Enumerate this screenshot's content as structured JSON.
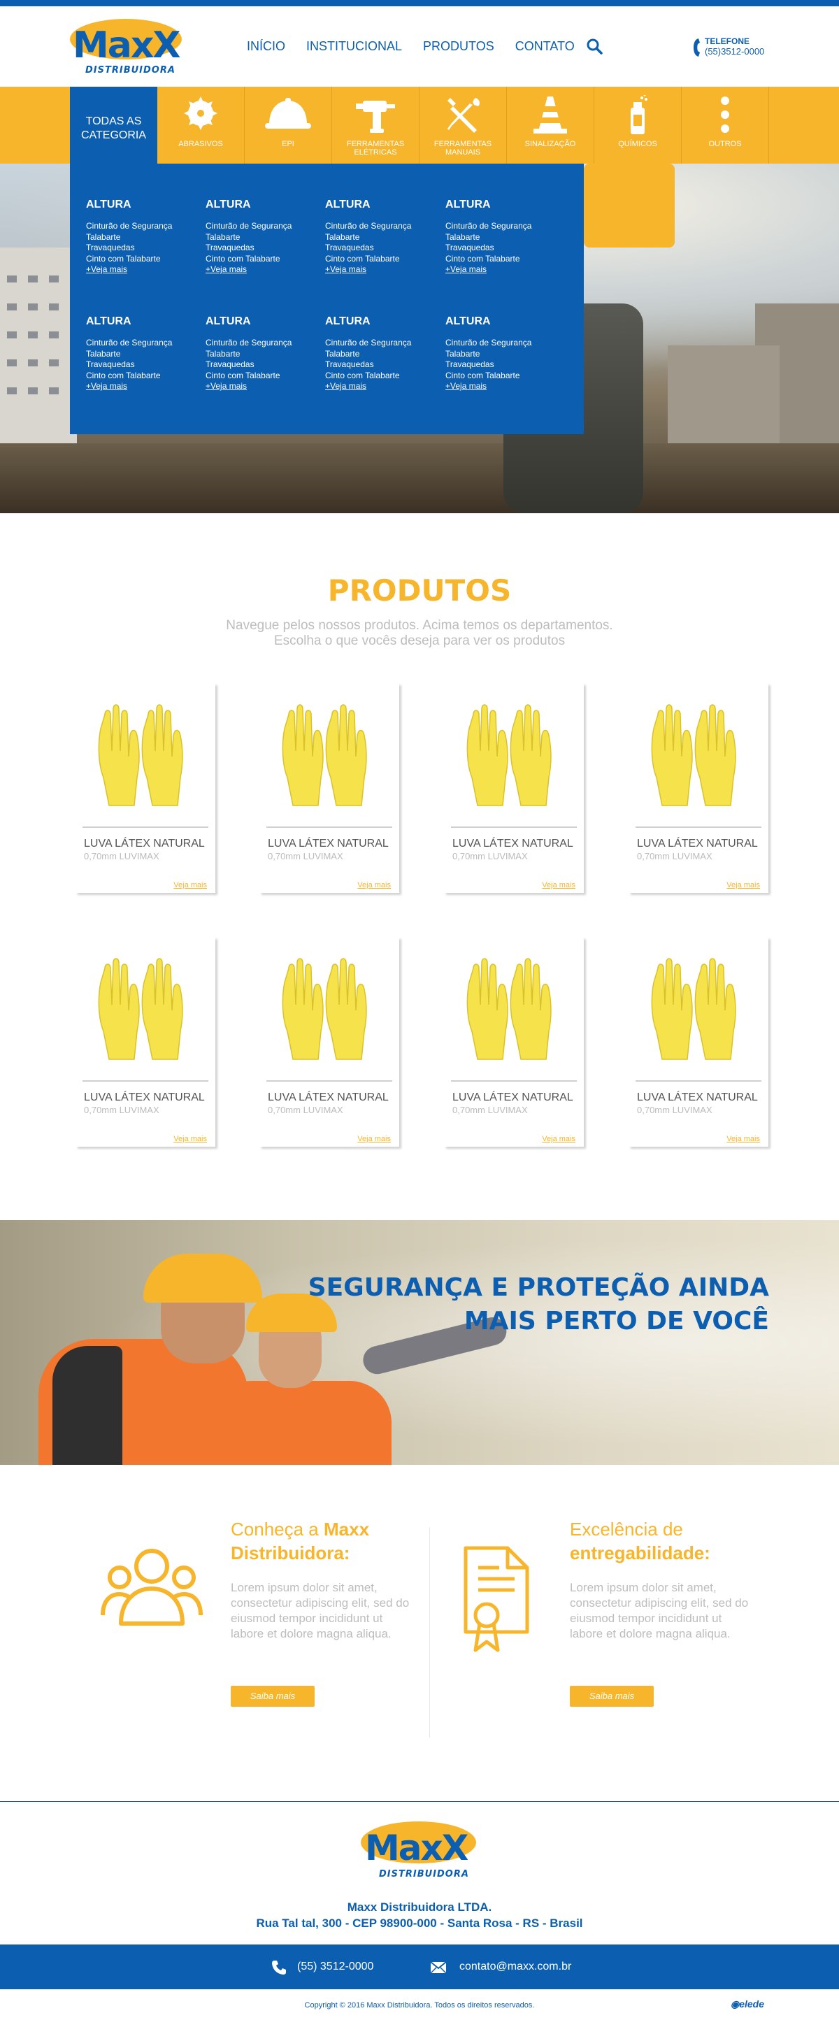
{
  "header": {
    "logo_text": "MaxX",
    "logo_sub": "DISTRIBUIDORA",
    "nav": [
      "INÍCIO",
      "INSTITUCIONAL",
      "PRODUTOS",
      "CONTATO"
    ],
    "phone_label": "TELEFONE",
    "phone_number": "(55)3512-0000"
  },
  "categories": {
    "all_label_1": "TODAS AS",
    "all_label_2": "CATEGORIA",
    "items": [
      {
        "label": "ABRASIVOS",
        "icon": "saw-blade-icon"
      },
      {
        "label": "EPI",
        "icon": "hard-hat-icon"
      },
      {
        "label": "FERRAMENTAS ELÉTRICAS",
        "icon": "drill-icon"
      },
      {
        "label": "FERRAMENTAS MANUAIS",
        "icon": "tools-icon"
      },
      {
        "label": "SINALIZAÇÃO",
        "icon": "traffic-cone-icon"
      },
      {
        "label": "QUÍMICOS",
        "icon": "spray-can-icon"
      },
      {
        "label": "OUTROS",
        "icon": "more-dots-icon"
      }
    ]
  },
  "mega_menu": {
    "columns": [
      {
        "title": "ALTURA",
        "links": [
          "Cinturão de Segurança",
          "Talabarte",
          "Travaquedas",
          "Cinto com Talabarte"
        ],
        "more": "+Veja mais"
      },
      {
        "title": "ALTURA",
        "links": [
          "Cinturão de Segurança",
          "Talabarte",
          "Travaquedas",
          "Cinto com Talabarte"
        ],
        "more": "+Veja mais"
      },
      {
        "title": "ALTURA",
        "links": [
          "Cinturão de Segurança",
          "Talabarte",
          "Travaquedas",
          "Cinto com Talabarte"
        ],
        "more": "+Veja mais"
      },
      {
        "title": "ALTURA",
        "links": [
          "Cinturão de Segurança",
          "Talabarte",
          "Travaquedas",
          "Cinto com Talabarte"
        ],
        "more": "+Veja mais"
      },
      {
        "title": "ALTURA",
        "links": [
          "Cinturão de Segurança",
          "Talabarte",
          "Travaquedas",
          "Cinto com Talabarte"
        ],
        "more": "+Veja mais"
      },
      {
        "title": "ALTURA",
        "links": [
          "Cinturão de Segurança",
          "Talabarte",
          "Travaquedas",
          "Cinto com Talabarte"
        ],
        "more": "+Veja mais"
      },
      {
        "title": "ALTURA",
        "links": [
          "Cinturão de Segurança",
          "Talabarte",
          "Travaquedas",
          "Cinto com Talabarte"
        ],
        "more": "+Veja mais"
      },
      {
        "title": "ALTURA",
        "links": [
          "Cinturão de Segurança",
          "Talabarte",
          "Travaquedas",
          "Cinto com Talabarte"
        ],
        "more": "+Veja mais"
      }
    ]
  },
  "products": {
    "title": "PRODUTOS",
    "subtitle_1": "Navegue pelos nossos produtos. Acima temos os departamentos.",
    "subtitle_2": "Escolha o que vocês deseja para ver os produtos",
    "items": [
      {
        "name": "LUVA LÁTEX NATURAL",
        "spec": "0,70mm LUVIMAX",
        "more": "Veja mais"
      },
      {
        "name": "LUVA LÁTEX NATURAL",
        "spec": "0,70mm LUVIMAX",
        "more": "Veja mais"
      },
      {
        "name": "LUVA LÁTEX NATURAL",
        "spec": "0,70mm LUVIMAX",
        "more": "Veja mais"
      },
      {
        "name": "LUVA LÁTEX NATURAL",
        "spec": "0,70mm LUVIMAX",
        "more": "Veja mais"
      },
      {
        "name": "LUVA LÁTEX NATURAL",
        "spec": "0,70mm LUVIMAX",
        "more": "Veja mais"
      },
      {
        "name": "LUVA LÁTEX NATURAL",
        "spec": "0,70mm LUVIMAX",
        "more": "Veja mais"
      },
      {
        "name": "LUVA LÁTEX NATURAL",
        "spec": "0,70mm LUVIMAX",
        "more": "Veja mais"
      },
      {
        "name": "LUVA LÁTEX NATURAL",
        "spec": "0,70mm LUVIMAX",
        "more": "Veja mais"
      }
    ]
  },
  "banner": {
    "line_1": "SEGURANÇA E PROTEÇÃO AINDA",
    "line_2": "MAIS PERTO DE VOCÊ"
  },
  "info": {
    "left": {
      "heading_pre": "Conheça a ",
      "heading_bold_1": "Maxx",
      "heading_bold_2": "Distribuidora:",
      "text": "Lorem ipsum dolor sit amet, consectetur adipiscing elit, sed do eiusmod tempor incididunt ut labore et dolore magna aliqua.",
      "button": "Saiba mais"
    },
    "right": {
      "heading_1": "Excelência de",
      "heading_bold": "entregabilidade:",
      "text": "Lorem ipsum dolor sit amet, consectetur adipiscing elit, sed do eiusmod tempor incididunt ut labore et dolore magna aliqua.",
      "button": "Saiba mais"
    }
  },
  "footer": {
    "company_line_1": "Maxx Distribuidora LTDA.",
    "company_line_2": "Rua Tal tal, 300 - CEP 98900-000 - Santa Rosa - RS - Brasil",
    "phone": "(55) 3512-0000",
    "email": "contato@maxx.com.br",
    "copyright": "Copyright © 2016 Maxx Distribuidora. Todos os direitos reservados.",
    "developer": "elede"
  },
  "colors": {
    "brand_blue": "#0c5fb0",
    "brand_yellow": "#f7b52b"
  }
}
